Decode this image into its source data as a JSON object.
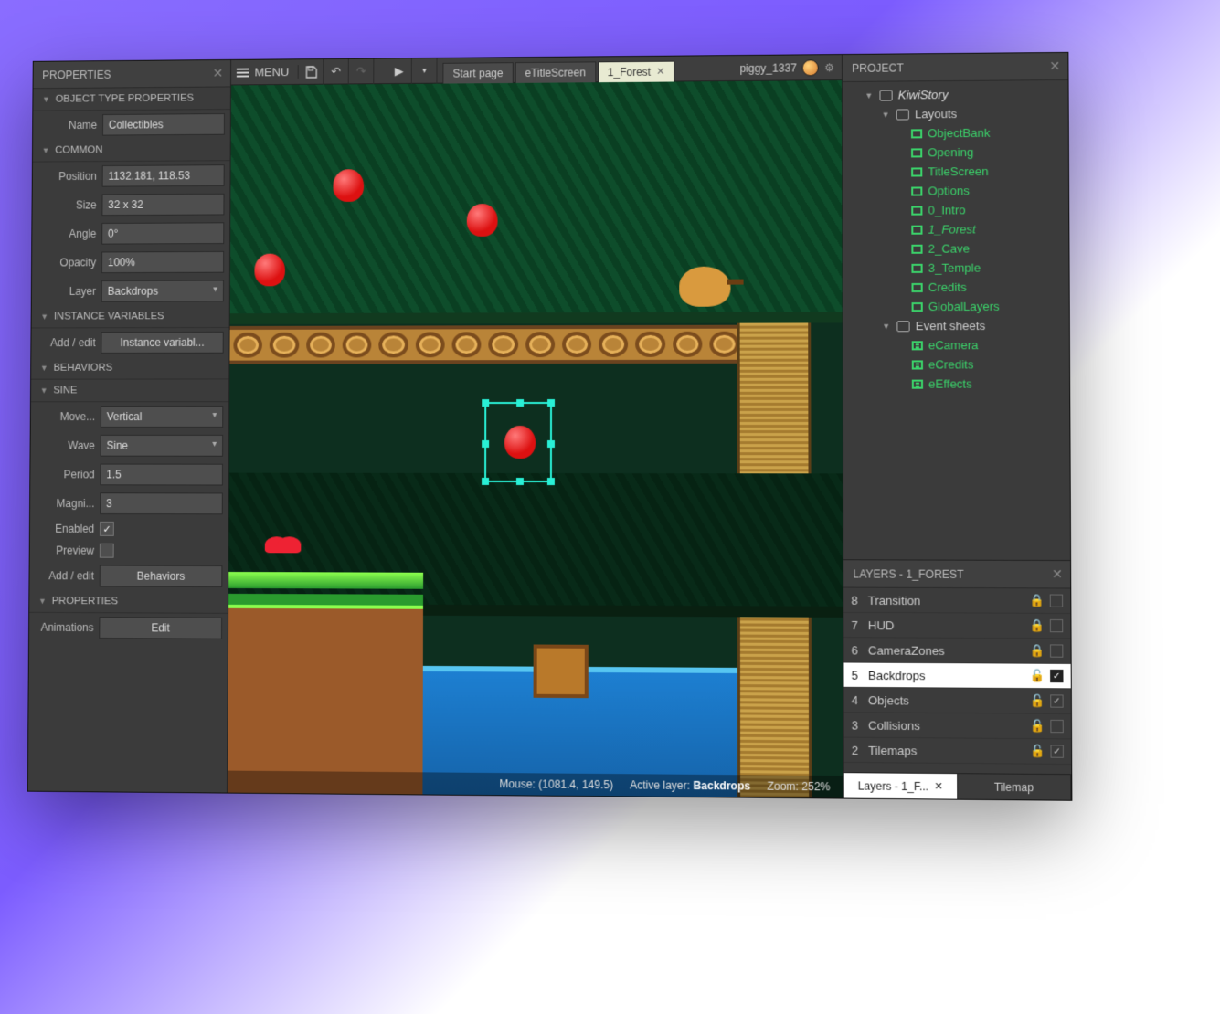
{
  "properties": {
    "panel_title": "PROPERTIES",
    "sections": {
      "object_type": "OBJECT TYPE PROPERTIES",
      "common": "COMMON",
      "instance_vars": "INSTANCE VARIABLES",
      "behaviors": "BEHAVIORS",
      "sine": "SINE",
      "properties2": "PROPERTIES"
    },
    "labels": {
      "name": "Name",
      "position": "Position",
      "size": "Size",
      "angle": "Angle",
      "opacity": "Opacity",
      "layer": "Layer",
      "add_edit": "Add / edit",
      "movement": "Move...",
      "wave": "Wave",
      "period": "Period",
      "magnitude": "Magni...",
      "enabled": "Enabled",
      "preview": "Preview",
      "animations": "Animations"
    },
    "values": {
      "name": "Collectibles",
      "position": "1132.181, 118.53",
      "size": "32 x 32",
      "angle": "0°",
      "opacity": "100%",
      "layer": "Backdrops",
      "instance_vars_btn": "Instance variabl...",
      "movement": "Vertical",
      "wave": "Sine",
      "period": "1.5",
      "magnitude": "3",
      "enabled": true,
      "preview": false,
      "behaviors_btn": "Behaviors",
      "edit_btn": "Edit"
    }
  },
  "toolbar": {
    "menu": "MENU",
    "tabs": [
      {
        "label": "Start page",
        "active": false,
        "closable": false
      },
      {
        "label": "eTitleScreen",
        "active": false,
        "closable": false
      },
      {
        "label": "1_Forest",
        "active": true,
        "closable": true
      }
    ],
    "user": "piggy_1337"
  },
  "statusbar": {
    "mouse_label": "Mouse:",
    "mouse": "(1081.4, 149.5)",
    "active_layer_label": "Active layer:",
    "active_layer": "Backdrops",
    "zoom_label": "Zoom:",
    "zoom": "252%"
  },
  "project": {
    "panel_title": "PROJECT",
    "root": "KiwiStory",
    "layouts_label": "Layouts",
    "layouts": [
      "ObjectBank",
      "Opening",
      "TitleScreen",
      "Options",
      "0_Intro",
      "1_Forest",
      "2_Cave",
      "3_Temple",
      "Credits",
      "GlobalLayers"
    ],
    "event_sheets_label": "Event sheets",
    "event_sheets": [
      "eCamera",
      "eCredits",
      "eEffects"
    ]
  },
  "layers": {
    "panel_title": "LAYERS - 1_FOREST",
    "rows": [
      {
        "num": "8",
        "name": "Transition",
        "locked": true,
        "visible": false,
        "active": false
      },
      {
        "num": "7",
        "name": "HUD",
        "locked": true,
        "visible": false,
        "active": false
      },
      {
        "num": "6",
        "name": "CameraZones",
        "locked": true,
        "visible": false,
        "active": false
      },
      {
        "num": "5",
        "name": "Backdrops",
        "locked": false,
        "visible": true,
        "active": true
      },
      {
        "num": "4",
        "name": "Objects",
        "locked": false,
        "visible": true,
        "active": false
      },
      {
        "num": "3",
        "name": "Collisions",
        "locked": false,
        "visible": false,
        "active": false
      },
      {
        "num": "2",
        "name": "Tilemaps",
        "locked": false,
        "visible": true,
        "active": false
      }
    ],
    "tabs": [
      {
        "label": "Layers - 1_F...",
        "active": true,
        "closable": true
      },
      {
        "label": "Tilemap",
        "active": false,
        "closable": false
      }
    ]
  }
}
